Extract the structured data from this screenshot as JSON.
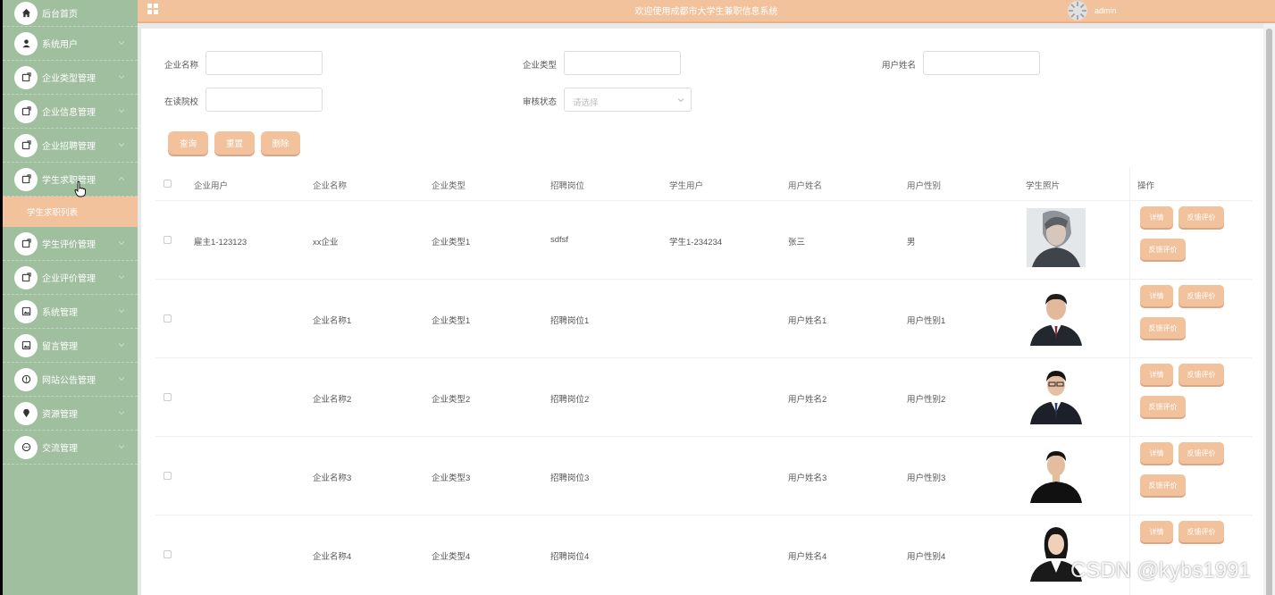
{
  "app": {
    "title": "欢迎使用成都市大学生兼职信息系统",
    "user": "admin"
  },
  "colors": {
    "sidebar": "#9fbf9f",
    "accent": "#f2c29c",
    "header": "#f2c29c"
  },
  "sidebar": {
    "items": [
      {
        "label": "后台首页",
        "icon": "home-icon"
      },
      {
        "label": "系统用户",
        "icon": "user-icon"
      },
      {
        "label": "企业类型管理",
        "icon": "edit-icon"
      },
      {
        "label": "企业信息管理",
        "icon": "edit-icon"
      },
      {
        "label": "企业招聘管理",
        "icon": "edit-icon"
      },
      {
        "label": "学生求职管理",
        "icon": "edit-icon"
      },
      {
        "label": "学生评价管理",
        "icon": "edit-icon"
      },
      {
        "label": "企业评价管理",
        "icon": "edit-icon"
      },
      {
        "label": "系统管理",
        "icon": "image-icon"
      },
      {
        "label": "留言管理",
        "icon": "image-icon"
      },
      {
        "label": "网站公告管理",
        "icon": "info-icon"
      },
      {
        "label": "资源管理",
        "icon": "location-icon"
      },
      {
        "label": "交流管理",
        "icon": "chat-icon"
      }
    ],
    "sub_item": "学生求职列表"
  },
  "filters": {
    "company_name": {
      "label": "企业名称",
      "value": ""
    },
    "company_type": {
      "label": "企业类型",
      "value": ""
    },
    "user_name": {
      "label": "用户姓名",
      "value": ""
    },
    "school": {
      "label": "在读院校",
      "value": ""
    },
    "audit_status": {
      "label": "审核状态",
      "placeholder": "请选择"
    }
  },
  "buttons": {
    "query": "查询",
    "reset": "重置",
    "delete": "删除"
  },
  "table": {
    "headers": [
      "企业用户",
      "企业名称",
      "企业类型",
      "招聘岗位",
      "学生用户",
      "用户姓名",
      "用户性别",
      "学生照片",
      "操作"
    ],
    "rows": [
      {
        "company_user": "雇主1-123123",
        "company_name": "xx企业",
        "company_type": "企业类型1",
        "position": "sdfsf",
        "student_user": "学生1-234234",
        "user_name": "张三",
        "gender": "男"
      },
      {
        "company_user": "",
        "company_name": "企业名称1",
        "company_type": "企业类型1",
        "position": "招聘岗位1",
        "student_user": "",
        "user_name": "用户姓名1",
        "gender": "用户性别1"
      },
      {
        "company_user": "",
        "company_name": "企业名称2",
        "company_type": "企业类型2",
        "position": "招聘岗位2",
        "student_user": "",
        "user_name": "用户姓名2",
        "gender": "用户性别2"
      },
      {
        "company_user": "",
        "company_name": "企业名称3",
        "company_type": "企业类型3",
        "position": "招聘岗位3",
        "student_user": "",
        "user_name": "用户姓名3",
        "gender": "用户性别3"
      },
      {
        "company_user": "",
        "company_name": "企业名称4",
        "company_type": "企业类型4",
        "position": "招聘岗位4",
        "student_user": "",
        "user_name": "用户姓名4",
        "gender": "用户性别4"
      }
    ],
    "actions": {
      "detail": "详情",
      "feedback": "反馈评价"
    }
  },
  "watermark": "CSDN @kybs1991"
}
